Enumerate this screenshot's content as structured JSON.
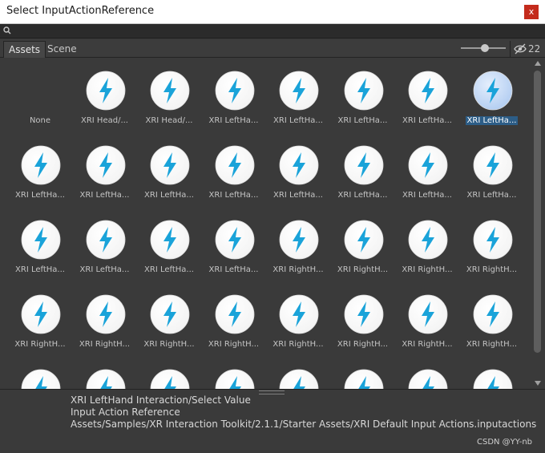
{
  "window": {
    "title": "Select InputActionReference",
    "close_label": "x"
  },
  "search": {
    "value": "",
    "placeholder": ""
  },
  "tabs": [
    {
      "label": "Assets",
      "active": true
    },
    {
      "label": "Scene",
      "active": false
    }
  ],
  "hidden_count": "22",
  "slider": {
    "value": 0.55
  },
  "assets": [
    {
      "label": "None",
      "icon": "none"
    },
    {
      "label": "XRI Head/...",
      "icon": "lightning-icon"
    },
    {
      "label": "XRI Head/...",
      "icon": "lightning-icon"
    },
    {
      "label": "XRI LeftHa...",
      "icon": "lightning-icon"
    },
    {
      "label": "XRI LeftHa...",
      "icon": "lightning-icon"
    },
    {
      "label": "XRI LeftHa...",
      "icon": "lightning-icon"
    },
    {
      "label": "XRI LeftHa...",
      "icon": "lightning-icon"
    },
    {
      "label": "XRI LeftHa...",
      "icon": "lightning-icon",
      "selected": true
    },
    {
      "label": "XRI LeftHa...",
      "icon": "lightning-icon"
    },
    {
      "label": "XRI LeftHa...",
      "icon": "lightning-icon"
    },
    {
      "label": "XRI LeftHa...",
      "icon": "lightning-icon"
    },
    {
      "label": "XRI LeftHa...",
      "icon": "lightning-icon"
    },
    {
      "label": "XRI LeftHa...",
      "icon": "lightning-icon"
    },
    {
      "label": "XRI LeftHa...",
      "icon": "lightning-icon"
    },
    {
      "label": "XRI LeftHa...",
      "icon": "lightning-icon"
    },
    {
      "label": "XRI LeftHa...",
      "icon": "lightning-icon"
    },
    {
      "label": "XRI LeftHa...",
      "icon": "lightning-icon"
    },
    {
      "label": "XRI LeftHa...",
      "icon": "lightning-icon"
    },
    {
      "label": "XRI LeftHa...",
      "icon": "lightning-icon"
    },
    {
      "label": "XRI LeftHa...",
      "icon": "lightning-icon"
    },
    {
      "label": "XRI RightH...",
      "icon": "lightning-icon"
    },
    {
      "label": "XRI RightH...",
      "icon": "lightning-icon"
    },
    {
      "label": "XRI RightH...",
      "icon": "lightning-icon"
    },
    {
      "label": "XRI RightH...",
      "icon": "lightning-icon"
    },
    {
      "label": "XRI RightH...",
      "icon": "lightning-icon"
    },
    {
      "label": "XRI RightH...",
      "icon": "lightning-icon"
    },
    {
      "label": "XRI RightH...",
      "icon": "lightning-icon"
    },
    {
      "label": "XRI RightH...",
      "icon": "lightning-icon"
    },
    {
      "label": "XRI RightH...",
      "icon": "lightning-icon"
    },
    {
      "label": "XRI RightH...",
      "icon": "lightning-icon"
    },
    {
      "label": "XRI RightH...",
      "icon": "lightning-icon"
    },
    {
      "label": "XRI RightH...",
      "icon": "lightning-icon"
    },
    {
      "label": "",
      "icon": "lightning-icon"
    },
    {
      "label": "",
      "icon": "lightning-icon"
    },
    {
      "label": "",
      "icon": "lightning-icon"
    },
    {
      "label": "",
      "icon": "lightning-icon"
    },
    {
      "label": "",
      "icon": "lightning-icon"
    },
    {
      "label": "",
      "icon": "lightning-icon"
    },
    {
      "label": "",
      "icon": "lightning-icon"
    },
    {
      "label": "",
      "icon": "lightning-icon"
    }
  ],
  "info": {
    "name": "XRI LeftHand Interaction/Select Value",
    "type": "Input Action Reference",
    "path": "Assets/Samples/XR Interaction Toolkit/2.1.1/Starter Assets/XRI Default Input Actions.inputactions"
  },
  "watermark": "CSDN @YY-nb",
  "colors": {
    "accent": "#1aa3d9",
    "selection": "#2c5d87",
    "close": "#c42b1c"
  }
}
